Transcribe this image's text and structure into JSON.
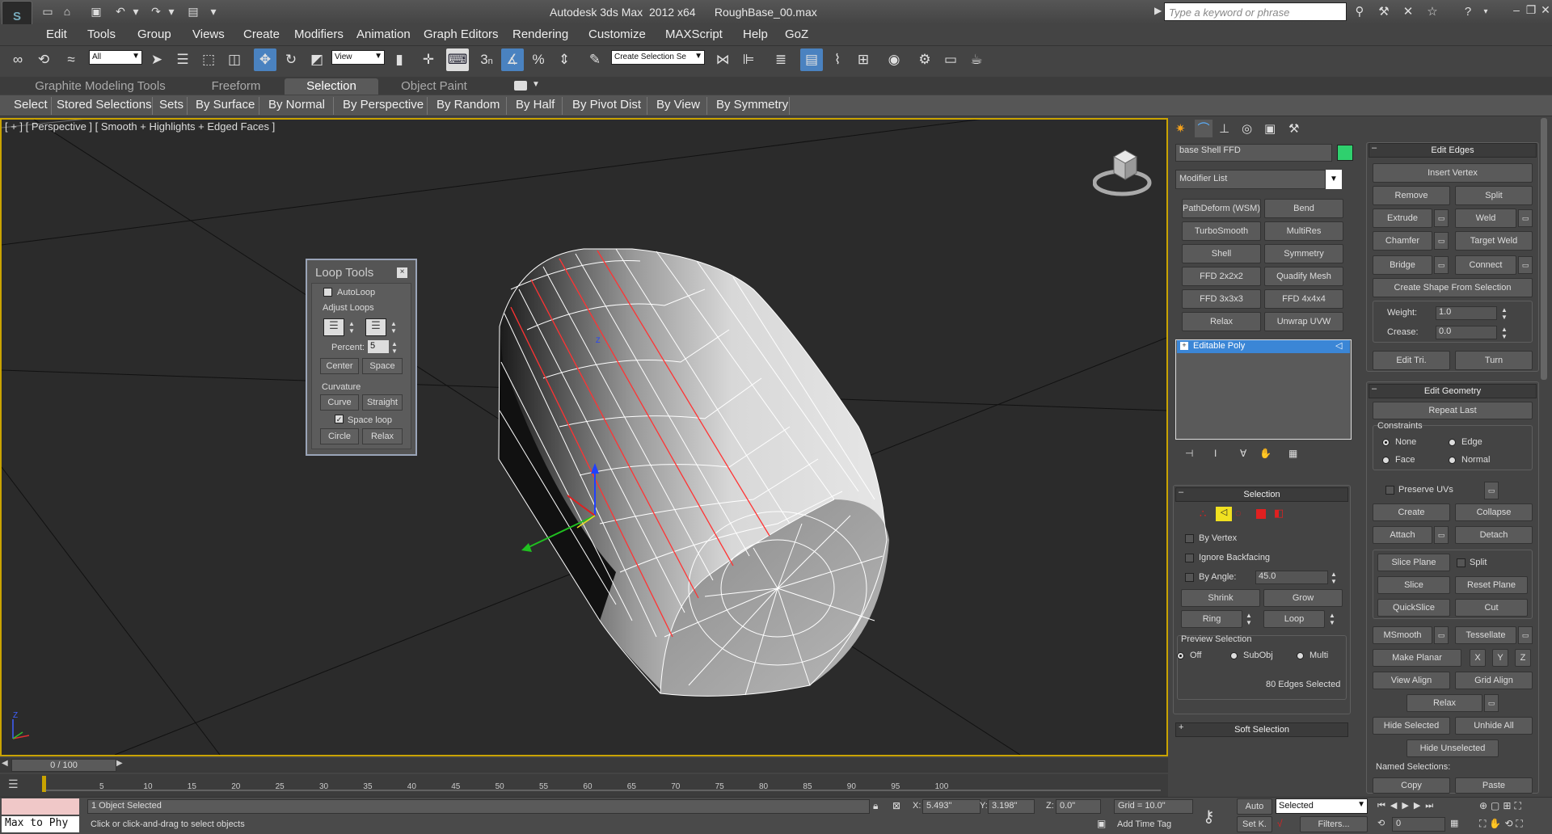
{
  "window": {
    "title": "Autodesk 3ds Max  2012 x64      RoughBase_00.max",
    "search_placeholder": "Type a keyword or phrase",
    "logo_glyph": "S"
  },
  "menu": [
    "Edit",
    "Tools",
    "Group",
    "Views",
    "Create",
    "Modifiers",
    "Animation",
    "Graph Editors",
    "Rendering",
    "Customize",
    "MAXScript",
    "Help",
    "GoZ"
  ],
  "toolbar": {
    "filter_value": "All",
    "refcoord_value": "View",
    "selection_set_value": "Create Selection Se",
    "snap_number": "3",
    "snap_suffix": "n",
    "percent_snap": "%",
    "icons": [
      "link-icon",
      "unlink-icon",
      "bind-spacewarp-icon",
      "select-object-icon",
      "select-by-name-icon",
      "rect-region-icon",
      "window-crossing-icon",
      "select-move-icon",
      "select-rotate-icon",
      "select-scale-icon",
      "mirror-icon",
      "align-icon",
      "layer-manager-icon",
      "graphite-toggle-icon",
      "curve-editor-icon",
      "schematic-view-icon",
      "material-editor-icon",
      "render-setup-icon",
      "rendered-frame-icon",
      "render-production-icon"
    ]
  },
  "ribbon": {
    "tabs": [
      "Graphite Modeling Tools",
      "Freeform",
      "Selection",
      "Object Paint"
    ],
    "active_tab": "Selection",
    "items": [
      "Select",
      "Stored Selections",
      "Sets",
      "By Surface",
      "By Normal",
      "By Perspective",
      "By Random",
      "By Half",
      "By Pivot Dist",
      "By View",
      "By Symmetry"
    ]
  },
  "viewport": {
    "label": "[ + ] [ Perspective ] [ Smooth + Highlights + Edged Faces ]",
    "border_color": "#c9a300",
    "axis_z": "Z",
    "axis_x": "X",
    "axis_y": "Y"
  },
  "loop_tools": {
    "title": "Loop Tools",
    "autoloop": "AutoLoop",
    "autoloop_checked": false,
    "adjust_loops": "Adjust Loops",
    "percent_label": "Percent:",
    "percent_value": "5",
    "center": "Center",
    "space": "Space",
    "curvature": "Curvature",
    "curve": "Curve",
    "straight": "Straight",
    "space_loop": "Space loop",
    "space_loop_checked": true,
    "circle": "Circle",
    "relax": "Relax"
  },
  "command_panel": {
    "object_name": "base Shell FFD",
    "object_color": "#2fd06e",
    "modifier_list": "Modifier List",
    "modifier_buttons": [
      [
        "PathDeform (WSM)",
        "Bend"
      ],
      [
        "TurboSmooth",
        "MultiRes"
      ],
      [
        "Shell",
        "Symmetry"
      ],
      [
        "FFD 2x2x2",
        "Quadify Mesh"
      ],
      [
        "FFD 3x3x3",
        "FFD 4x4x4"
      ],
      [
        "Relax",
        "Unwrap UVW"
      ]
    ],
    "stack_item": "Editable Poly",
    "selection": {
      "title": "Selection",
      "by_vertex": "By Vertex",
      "ignore_backfacing": "Ignore Backfacing",
      "by_angle": "By Angle:",
      "angle_value": "45.0",
      "shrink": "Shrink",
      "grow": "Grow",
      "ring": "Ring",
      "loop": "Loop",
      "preview_selection": "Preview Selection",
      "off": "Off",
      "subobj": "SubObj",
      "multi": "Multi",
      "status": "80 Edges Selected"
    },
    "soft_selection": "Soft Selection"
  },
  "edit_edges": {
    "title": "Edit Edges",
    "insert_vertex": "Insert Vertex",
    "remove": "Remove",
    "split": "Split",
    "extrude": "Extrude",
    "weld": "Weld",
    "chamfer": "Chamfer",
    "target_weld": "Target Weld",
    "bridge": "Bridge",
    "connect": "Connect",
    "create_shape": "Create Shape From Selection",
    "weight_label": "Weight:",
    "weight_value": "1.0",
    "crease_label": "Crease:",
    "crease_value": "0.0",
    "edit_tri": "Edit Tri.",
    "turn": "Turn"
  },
  "edit_geometry": {
    "title": "Edit Geometry",
    "repeat_last": "Repeat Last",
    "constraints": "Constraints",
    "none": "None",
    "edge": "Edge",
    "face": "Face",
    "normal": "Normal",
    "preserve_uvs": "Preserve UVs",
    "create": "Create",
    "collapse": "Collapse",
    "attach": "Attach",
    "detach": "Detach",
    "slice_plane": "Slice Plane",
    "split": "Split",
    "slice": "Slice",
    "reset_plane": "Reset Plane",
    "quickslice": "QuickSlice",
    "cut": "Cut",
    "msmooth": "MSmooth",
    "tessellate": "Tessellate",
    "make_planar": "Make Planar",
    "x": "X",
    "y": "Y",
    "z": "Z",
    "view_align": "View Align",
    "grid_align": "Grid Align",
    "relax": "Relax",
    "hide_selected": "Hide Selected",
    "unhide_all": "Unhide All",
    "hide_unselected": "Hide Unselected",
    "named_selections": "Named Selections:",
    "copy": "Copy",
    "paste": "Paste"
  },
  "timeline": {
    "frame": "0 / 100",
    "ticks": [
      "5",
      "10",
      "15",
      "20",
      "25",
      "30",
      "35",
      "40",
      "45",
      "50",
      "55",
      "60",
      "65",
      "70",
      "75",
      "80",
      "85",
      "90",
      "95",
      "100"
    ]
  },
  "status": {
    "script_listener": "Max to Phy",
    "selected_count": "1 Object Selected",
    "prompt": "Click or click-and-drag to select objects",
    "x_label": "X:",
    "x_value": "5.493\"",
    "y_label": "Y:",
    "y_value": "3.198\"",
    "z_label": "Z:",
    "z_value": "0.0\"",
    "grid": "Grid = 10.0\"",
    "add_time_tag": "Add Time Tag",
    "auto": "Auto",
    "set_key": "Set K.",
    "selected_dropdown": "Selected",
    "filters": "Filters...",
    "frame_value": "0"
  }
}
